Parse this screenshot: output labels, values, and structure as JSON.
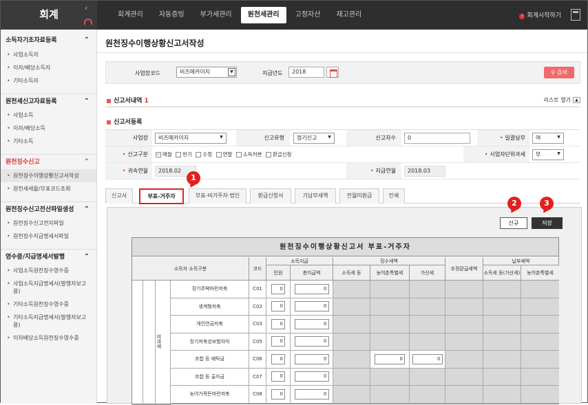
{
  "app": {
    "title": "회계"
  },
  "nav": [
    "회계관리",
    "자동증빙",
    "부가세관리",
    "원천세관리",
    "고정자산",
    "재고관리"
  ],
  "nav_active": "원천세관리",
  "start_link": "회계시작하기",
  "sidebar": {
    "sections": [
      {
        "title": "소득자기초자료등록",
        "items": [
          "사업소득자",
          "이자/배당소득자",
          "기타소득자"
        ]
      },
      {
        "title": "원천세신고자료등록",
        "items": [
          "사업소득",
          "이자/배당소득",
          "기타소득"
        ]
      },
      {
        "title": "원천징수신고",
        "items": [
          "원천징수이행상황신고서작성",
          "원천세세율/부표코드조회"
        ]
      },
      {
        "title": "원천징수신고전산파일생성",
        "items": [
          "원천징수신고전자파일",
          "원천징수지급명세서파일"
        ]
      },
      {
        "title": "영수증/지급명세서발행",
        "items": [
          "사업소득원천징수영수증",
          "사업소득지급명세서(발행자보고용)",
          "기타소득원천징수영수증",
          "기타소득지급명세서(발행자보고용)",
          "이자배당소득원천징수영수증"
        ]
      }
    ]
  },
  "page_title": "원천징수이행상황신고서작성",
  "search": {
    "biz_label": "사업장코드",
    "biz_value": "비즈메카이지",
    "year_label": "지급년도",
    "year_value": "2018",
    "search_btn": "검색"
  },
  "history": {
    "label": "신고서내역",
    "count": "1",
    "toggle": "리스트 열기"
  },
  "register": {
    "label": "신고서등록",
    "biz_label": "사업장",
    "biz_value": "비즈메카이지",
    "type_label": "신고유형",
    "type_value": "정기신고",
    "seq_label": "신고차수",
    "seq_value": "0",
    "bulk_label": "일괄납부",
    "bulk_value": "여",
    "kind_label": "신고구분",
    "kinds": [
      "매월",
      "반기",
      "수정",
      "연말",
      "소득처분",
      "환급신청"
    ],
    "unit_label": "사업자단위과세",
    "unit_value": "부",
    "belong_label": "귀속연월",
    "belong_value": "2018.02",
    "pay_label": "지급연월",
    "pay_value": "2018.03"
  },
  "tabs": [
    "신고서",
    "부표-거주자",
    "부표-비거주자·법인",
    "환급신청서",
    "기납부세액",
    "전월미환급",
    "인쇄"
  ],
  "tab_active": "부표-거주자",
  "callouts": [
    "1",
    "2",
    "3"
  ],
  "actions": {
    "new": "신규",
    "save": "저장"
  },
  "report": {
    "title": "원천징수이행상황신고서 부표-거주자",
    "headers": {
      "category": "소득자 소득구분",
      "code": "코드",
      "payment": "소득지급",
      "count": "인원",
      "total": "총지급액",
      "withheld": "징수세액",
      "income_tax": "소득세 등",
      "rural_tax": "농어촌특별세",
      "penalty": "가산세",
      "adjust": "조정환급세액",
      "paid": "납부세액",
      "paid_income": "소득세 등(가산세)",
      "paid_rural": "농어촌특별세"
    },
    "side_label": "비과세",
    "rows": [
      {
        "name": "장기주택마련저축",
        "code": "C01",
        "count": "0",
        "total": "0"
      },
      {
        "name": "생계형저축",
        "code": "C02",
        "count": "0",
        "total": "0"
      },
      {
        "name": "개인연금저축",
        "code": "C03",
        "count": "0",
        "total": "0"
      },
      {
        "name": "장기저축성보험차익",
        "code": "C05",
        "count": "0",
        "total": "0"
      },
      {
        "name": "조합 등 예탁금",
        "code": "C06",
        "count": "0",
        "total": "0",
        "rural": "0",
        "penalty": "0"
      },
      {
        "name": "조합 등 출자금",
        "code": "C07",
        "count": "0",
        "total": "0"
      },
      {
        "name": "농어가목돈마련저축",
        "code": "C08",
        "count": "0",
        "total": "0"
      }
    ]
  }
}
